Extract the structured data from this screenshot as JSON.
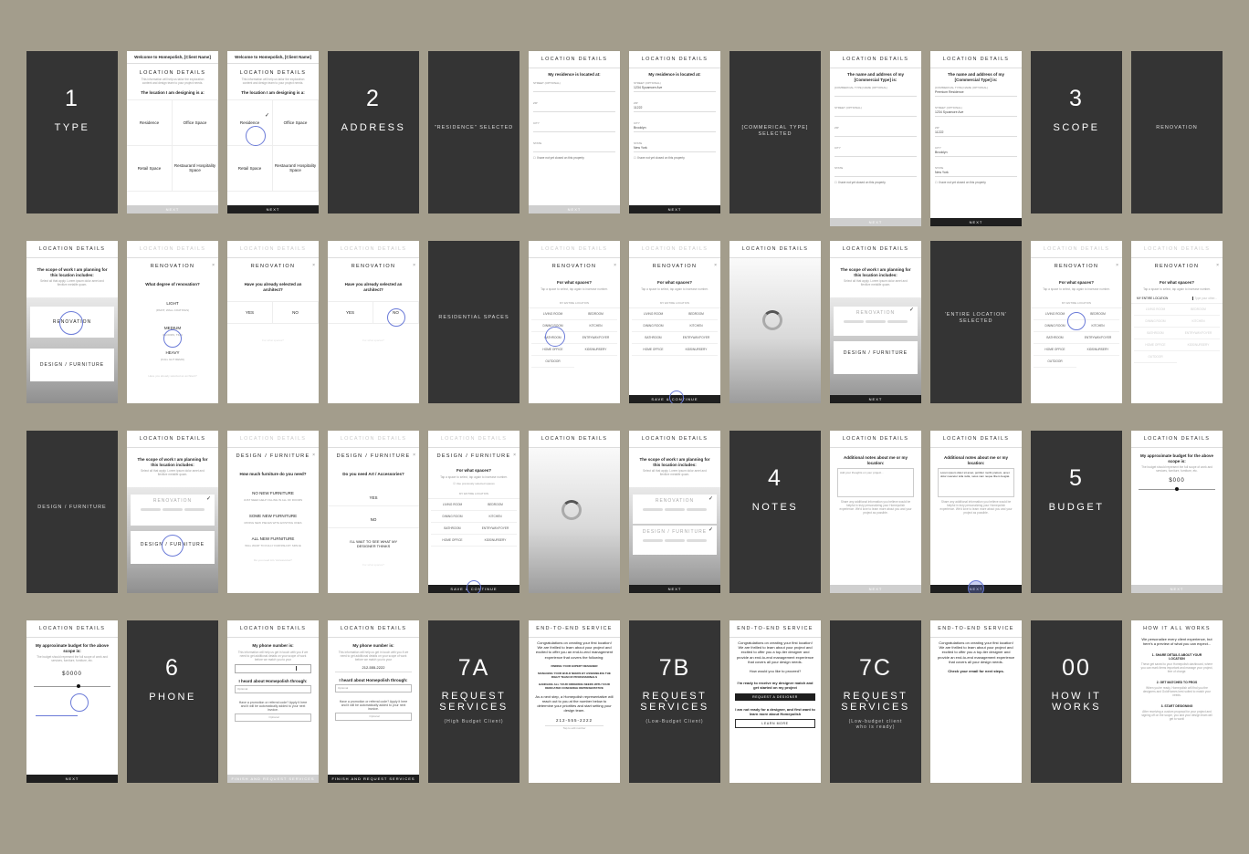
{
  "common": {
    "location_details": "LOCATION DETAILS",
    "next": "NEXT",
    "renovation": "RENOVATION",
    "design_furniture": "DESIGN / FURNITURE",
    "end_to_end": "END-TO-END SERVICE",
    "save_continue": "SAVE & CONTINUE",
    "finish": "FINISH AND REQUEST SERVICES",
    "not_closed": "I have not yet closed on this property"
  },
  "row1": {
    "type_num": "1",
    "type_word": "TYPE",
    "welcome": "Welcome to Homepolish, [Client Name]",
    "intro": "This information will help us tailor the exploration content and design team to your project needs.",
    "designing_q": "The location I am designing is a:",
    "types": [
      "Residence",
      "Office Space",
      "Retail Space",
      "Restaurant/ Hospitality Space"
    ],
    "address_num": "2",
    "address_word": "ADDRESS",
    "residence_selected": "\"RESIDENCE\" SELECTED",
    "residence_located": "My residence is located at:",
    "street_label": "STREET (OPTIONAL)",
    "zip_label": "ZIP",
    "city_label": "CITY",
    "state_label": "STATE",
    "street_val": "1234 Sycamore Ave",
    "zip_val": "11222",
    "city_val": "Brooklyn",
    "state_val": "New York",
    "commercial_selected": "[COMMERICAL TYPE] SELECTED",
    "commercial_q": "The name and address of my [Commercial Type] is:",
    "biz_label": "[COMMERCIAL TYPE] NAME (OPTIONAL)",
    "biz_val": "Premium Residence",
    "scope_num": "3",
    "scope_word": "SCOPE",
    "renovation_word": "RENOVATION"
  },
  "row2": {
    "scope_q": "The scope of work I am planning for this location includes:",
    "scope_tiny": "Select all that apply. Lorem ipsum dolor amet and flexitive metalife quam.",
    "degree_q": "What degree of renovation?",
    "light": "LIGHT",
    "light_sub": "(PAINT, WALL COATINGS)",
    "medium": "MEDIUM",
    "medium_sub": "(FLOORS, TILE)",
    "heavy": "HEAVY",
    "heavy_sub": "(FULL GUT REMO)",
    "architect_q": "Have you already selected an architect?",
    "yes": "YES",
    "no": "NO",
    "residential_spaces": "RESIDENTIAL SPACES",
    "spaces_q": "For what spaces?",
    "spaces_tiny": "Tap a space to select, tap again to increase number.",
    "entire": "MY ENTIRE LOCATION",
    "spaces": [
      "LIVING ROOM",
      "BEDROOM",
      "DINING ROOM",
      "KITCHEN",
      "BATHROOM",
      "ENTRYWAY/FOYER",
      "HOME OFFICE",
      "KIDS/NURSERY",
      "OUTDOOR"
    ],
    "entire_selected": "'ENTIRE LOCATION' SELECTED",
    "other_placeholder": "Type your other..."
  },
  "row3": {
    "design_furniture_word": "DESIGN / FURNITURE",
    "furniture_q": "How much furniture do you need?",
    "no_new": "NO NEW FURNITURE",
    "no_new_sub": "JUST NEED HELP FILLING IN ALL OF ROOMS",
    "some_new": "SOME NEW FURNITURE",
    "some_new_sub": "MIXING NEW PIECES WITH EXISTING ONES",
    "all_new": "ALL NEW FURNITURE",
    "all_new_sub": "WILL WANT TO FULLY FURNISH MY SPACE",
    "art_q": "Do you need Art / Accessories?",
    "wait": "I'LL WAIT TO SEE WHAT MY DESIGNER THINKS",
    "use_prev": "Use previously selected spaces",
    "notes_num": "4",
    "notes_word": "NOTES",
    "notes_q": "Additional notes about me or my location:",
    "notes_ph": "Add your thoughts on your project...",
    "notes_val": "Lorem ipsum dolor sit amet, porttitor morbi pretium, amet dolor nascetur iulla nulla, netus nam neque libero feugiat.",
    "notes_tiny": "Share any additional information you believe would be helpful in truly personalizing your Homepolish experience. We'd love to learn more about you and your project as possible.",
    "budget_num": "5",
    "budget_word": "BUDGET",
    "budget_q": "My approximate budget for the above scope is:",
    "budget_tiny": "The budget should represent the full scope of work and services, furniture, furniture, etc.",
    "budget_val": "$000"
  },
  "row4": {
    "budget_val2": "$0000",
    "phone_num": "6",
    "phone_word": "PHONE",
    "phone_q": "My phone number is:",
    "phone_tiny": "This information will help us get in touch with you if we need to get additional details on your scope of work before we match you to your",
    "phone_val": "212-555-2222",
    "heard_q": "I heard about Homepolish through:",
    "optional": "Optional",
    "promo_q": "Have a promotion or referral code? Apply it here and it will be automatically added to your next invoice.",
    "r7a_num": "7A",
    "r7b_num": "7B",
    "r7c_num": "7C",
    "request": "REQUEST",
    "services": "SERVICES",
    "high_budget": "(High Budget Client)",
    "low_budget": "(Low-Budget Client)",
    "low_ready": "(Low-budget client who is ready)",
    "congrats": "Congratulations on creating your first location! We are thrilled to learn about your project and excited to offer you an end-to-end management experience that covers the following:",
    "finding": "FINDING YOUR EXPERT DESIGNER",
    "managing": "MANAGING YOUR BUILD NEEDS BY ASSEMBLING THE RIGHT TEAM OF PROFESSIONALS",
    "handling": "HANDLING ALL YOUR ORDERING NEEDS WITH YOUR DEDICATED CONCIERGE REPRESENTATIVE",
    "next_step": "As a next step, a Homepolish representative will reach out to you at the number below to determine your priorities and start setting your design team.",
    "rep_phone": "212-555-2222",
    "update_number": "Tap to edit number",
    "congrats_b": "Congratulations on creating your first location! We are thrilled to learn about your project and excited to offer you a top-tier designer and provide an end-to-end management experience that covers all your design needs.",
    "proceed_q": "How would you like to proceed?",
    "ready": "I'm ready to receive my designer match and get started on my project",
    "request_designer": "REQUEST A DESIGNER",
    "not_ready": "I am not ready for a designer, and first want to learn more about Homepolish",
    "learn_more": "LEARN MORE",
    "check_email": "Check your email for next steps.",
    "how_num": "00",
    "how_word1": "HOW IT",
    "how_word2": "WORKS",
    "how_title": "HOW IT ALL WORKS",
    "how_intro": "We personalize every client experience, but here's a preview of what you can expect...",
    "step1": "1. SHARE DETAILS ABOUT YOUR LOCATION",
    "step1_tiny": "These get saved to your Homepolish dashboard, where you can mark items important and manage your project, free of charge.",
    "step2": "2. GET MATCHED TO PROS",
    "step2_tiny": "When you're ready, Homepolish will find you the designers and GoldHomes best suited to match your needs.",
    "step3": "3. START DESIGNING",
    "step3_tiny": "After receiving a custom proposal for your project and signing off on the scope, you and your design team will get to work!"
  }
}
